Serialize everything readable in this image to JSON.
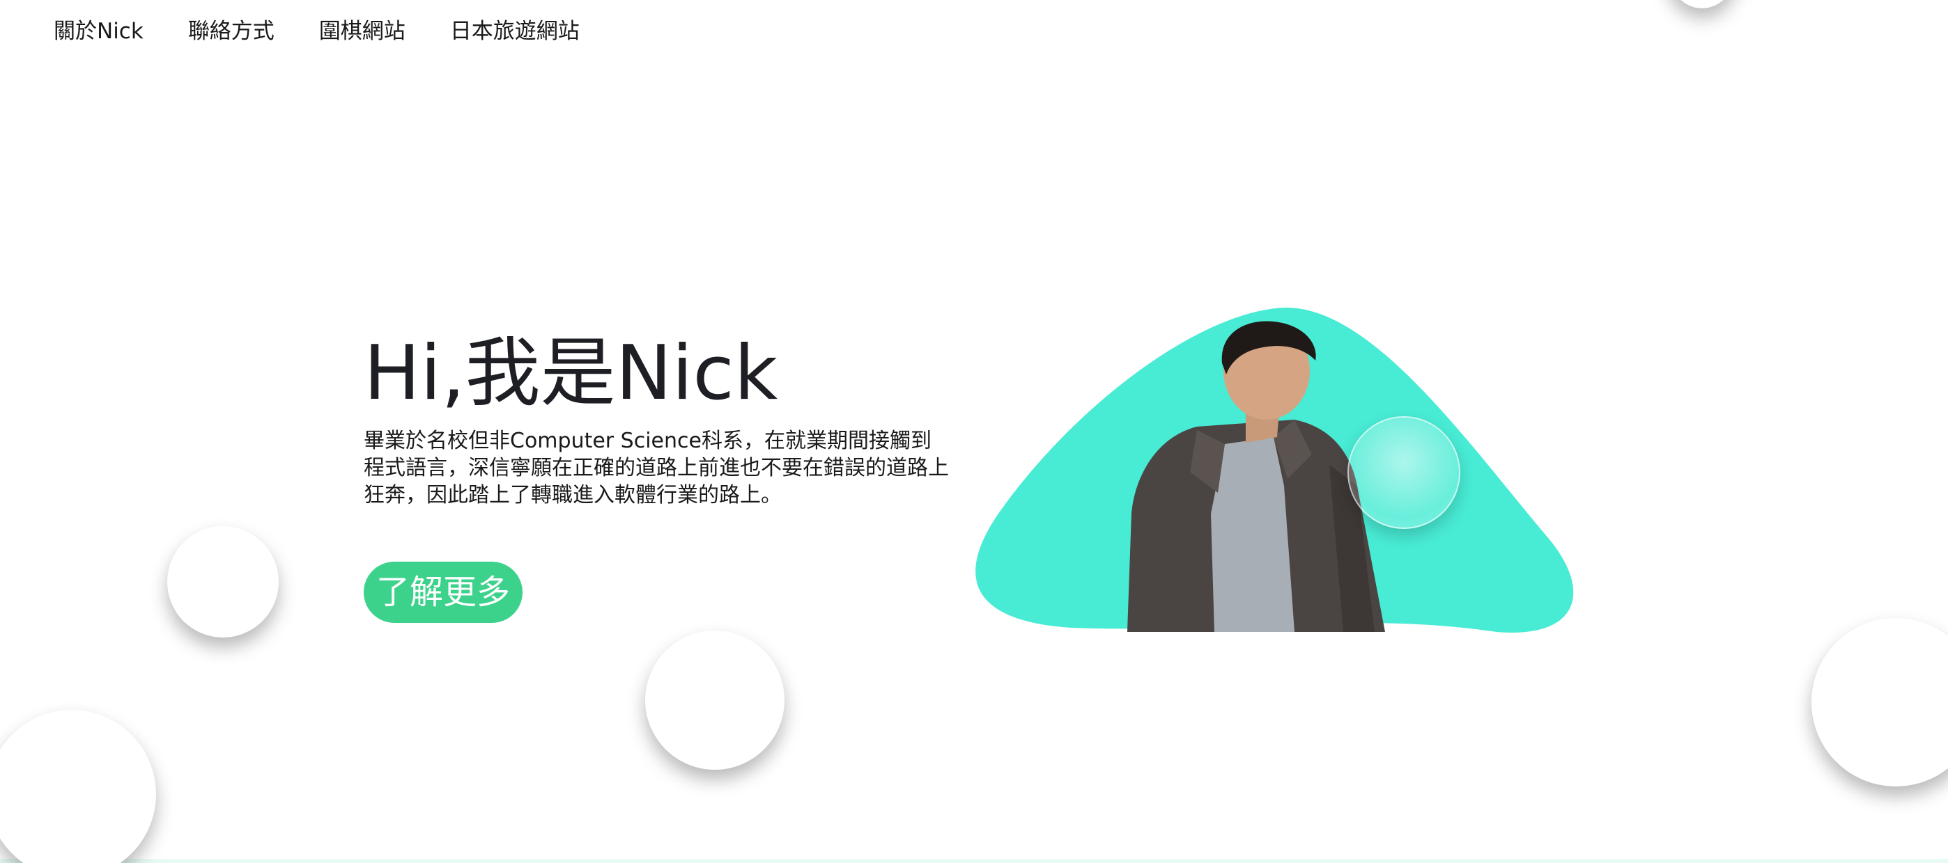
{
  "nav": {
    "items": [
      {
        "label": "關於Nick"
      },
      {
        "label": "聯絡方式"
      },
      {
        "label": "圍棋網站"
      },
      {
        "label": "日本旅遊網站"
      }
    ]
  },
  "hero": {
    "title": "Hi,我是Nick",
    "description": "畢業於名校但非Computer Science科系，在就業期間接觸到程式語言，深信寧願在正確的道路上前進也不要在錯誤的道路上狂奔，因此踏上了轉職進入軟體行業的路上。",
    "cta_label": "了解更多"
  },
  "colors": {
    "accent_blob": "#48ebd4",
    "cta": "#3dd28b",
    "title": "#1d1f24"
  },
  "icons": {
    "portrait": "person-portrait-image"
  }
}
